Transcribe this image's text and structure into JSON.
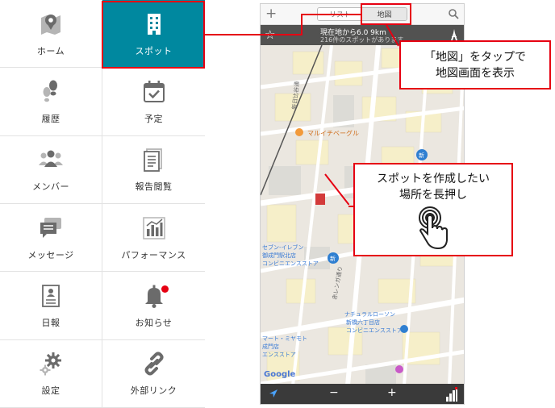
{
  "menu": {
    "items": [
      {
        "label": "ホーム",
        "icon": "map-pin-icon"
      },
      {
        "label": "スポット",
        "icon": "building-icon",
        "active": true
      },
      {
        "label": "履歴",
        "icon": "footsteps-icon"
      },
      {
        "label": "予定",
        "icon": "calendar-check-icon"
      },
      {
        "label": "メンバー",
        "icon": "people-icon"
      },
      {
        "label": "報告閲覧",
        "icon": "document-icon"
      },
      {
        "label": "メッセージ",
        "icon": "chat-icon"
      },
      {
        "label": "パフォーマンス",
        "icon": "bar-chart-icon"
      },
      {
        "label": "日報",
        "icon": "report-icon"
      },
      {
        "label": "お知らせ",
        "icon": "bell-icon"
      },
      {
        "label": "設定",
        "icon": "gear-icon"
      },
      {
        "label": "外部リンク",
        "icon": "link-icon"
      }
    ],
    "active_color": "#00889f"
  },
  "phone": {
    "segment": {
      "list": "リスト",
      "map": "地図"
    },
    "info": {
      "distance": "現在地から6.0 9km",
      "count": "216件のスポットがあります"
    },
    "map": {
      "poi_malui": "マルイチベーグル",
      "poi_seven_1": "セブン-イレブン",
      "poi_seven_2": "御成門駅北店",
      "poi_seven_3": "コンビニエンスストア",
      "poi_natural_1": "ナチュラルローソン",
      "poi_natural_2": "新橋六丁目店",
      "poi_natural_3": "コンビニエンスストア",
      "poi_mart_1": "マート・ミヤモト",
      "poi_mart_2": "成門店",
      "poi_mart_3": "エンスストア",
      "road_label": "赤レンガ通り",
      "road_label_2": "新日比谷通",
      "new_badge": "新",
      "google": "Google"
    },
    "bottom": {
      "minus": "−",
      "plus": "+"
    }
  },
  "callouts": {
    "map_tab": [
      "「地図」をタップで",
      "地図画面を表示"
    ],
    "long_press": [
      "スポットを作成したい",
      "場所を長押し"
    ]
  },
  "colors": {
    "highlight": "#e60012",
    "accent": "#00889f"
  }
}
